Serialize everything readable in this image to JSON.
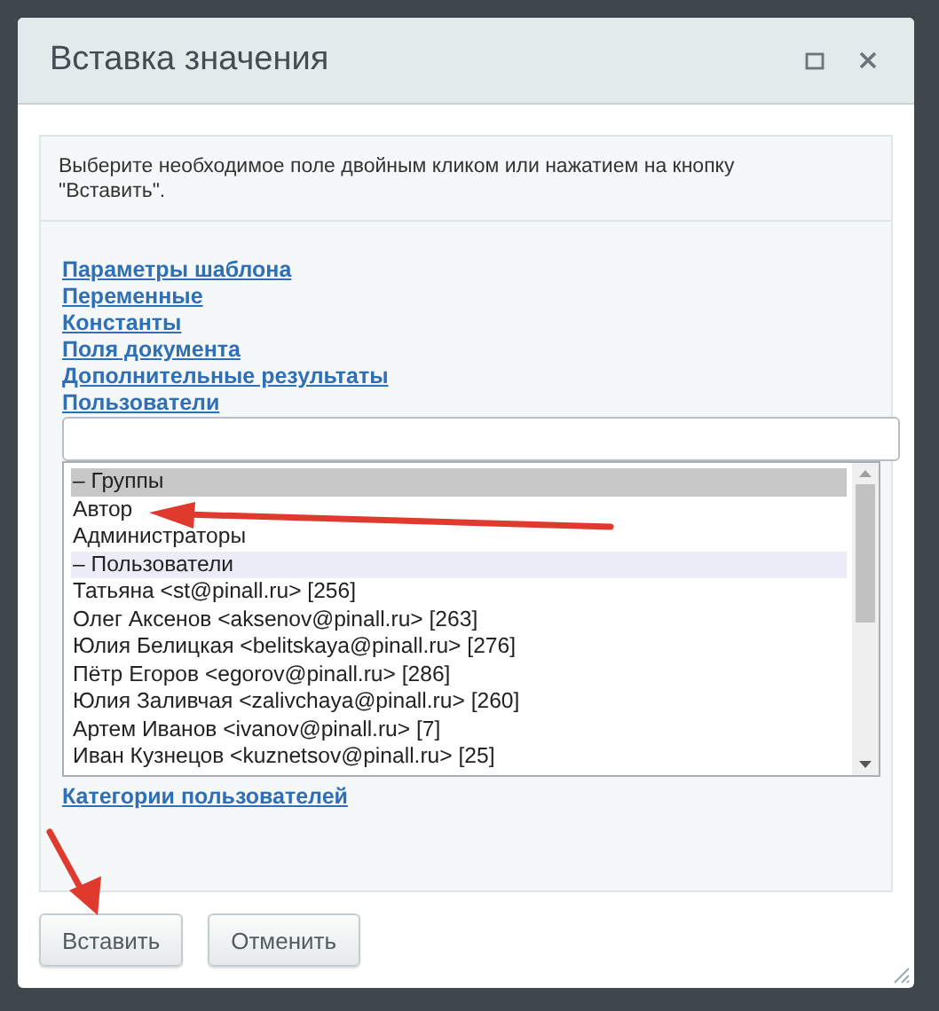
{
  "dialog": {
    "title": "Вставка значения"
  },
  "hint": "Выберите необходимое поле двойным кликом или нажатием на кнопку \"Вставить\".",
  "links": [
    "Параметры шаблона",
    "Переменные",
    "Константы",
    "Поля документа",
    "Дополнительные результаты",
    "Пользователи"
  ],
  "list": [
    {
      "text": "– Группы",
      "kind": "group",
      "selected": true
    },
    {
      "text": "Автор",
      "kind": "option",
      "selected": false
    },
    {
      "text": "Администраторы",
      "kind": "option",
      "selected": false
    },
    {
      "text": "– Пользователи",
      "kind": "group",
      "selected": false
    },
    {
      "text": "Татьяна <st@pinall.ru> [256]",
      "kind": "option",
      "selected": false
    },
    {
      "text": "Олег Аксенов <aksenov@pinall.ru> [263]",
      "kind": "option",
      "selected": false
    },
    {
      "text": "Юлия Белицкая <belitskaya@pinall.ru> [276]",
      "kind": "option",
      "selected": false
    },
    {
      "text": "Пётр Егоров <egorov@pinall.ru> [286]",
      "kind": "option",
      "selected": false
    },
    {
      "text": "Юлия Заливчая <zalivchaya@pinall.ru> [260]",
      "kind": "option",
      "selected": false
    },
    {
      "text": "Артем Иванов <ivanov@pinall.ru> [7]",
      "kind": "option",
      "selected": false
    },
    {
      "text": "Иван Кузнецов <kuznetsov@pinall.ru> [25]",
      "kind": "option",
      "selected": false
    }
  ],
  "after_link": "Категории пользователей",
  "buttons": [
    "Вставить",
    "Отменить"
  ]
}
